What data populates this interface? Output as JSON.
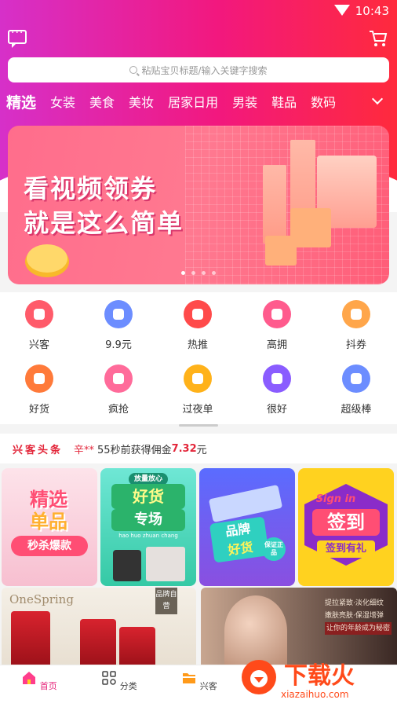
{
  "status_bar": {
    "time": "10:43"
  },
  "search": {
    "placeholder": "粘贴宝贝标题/输入关键字搜索"
  },
  "categories": [
    "精选",
    "女装",
    "美食",
    "美妆",
    "居家日用",
    "男装",
    "鞋品",
    "数码"
  ],
  "banner": {
    "line1": "看视频领券",
    "line2": "就是这么简单",
    "page_count": 4,
    "active_page": 1
  },
  "menu": {
    "row1": [
      {
        "label": "兴客",
        "icon": "clipboard-icon",
        "color": "#ff5b6a"
      },
      {
        "label": "9.9元",
        "icon": "heart-icon",
        "color": "#6c8dff"
      },
      {
        "label": "热推",
        "icon": "flame-icon",
        "color": "#ff4a4a"
      },
      {
        "label": "高拥",
        "icon": "clover-icon",
        "color": "#ff5b8d"
      },
      {
        "label": "抖券",
        "icon": "gift-icon",
        "color": "#ffa64a"
      }
    ],
    "row2": [
      {
        "label": "好货",
        "icon": "burger-icon",
        "color": "#ff7a3a"
      },
      {
        "label": "疯抢",
        "icon": "crown-icon",
        "color": "#ff6b9a"
      },
      {
        "label": "过夜单",
        "icon": "megaphone-icon",
        "color": "#ffb21a"
      },
      {
        "label": "很好",
        "icon": "thumbs-up-icon",
        "color": "#8a5cff"
      },
      {
        "label": "超级棒",
        "icon": "heart-icon",
        "color": "#6c8dff"
      }
    ]
  },
  "news": {
    "label": "兴客头条",
    "user": "辛**",
    "text": "55秒前获得佣金",
    "amount": "7.32",
    "unit": "元"
  },
  "tiles": [
    {
      "line1": "精选",
      "line2": "单品",
      "line3": "秒杀爆款"
    },
    {
      "top": "放量放心",
      "line1": "好货",
      "line2": "专场",
      "sub": "hao huo zhuan chang"
    },
    {
      "line1": "品牌",
      "line2": "好货",
      "badge": "保证正品"
    },
    {
      "en": "Sign in",
      "line1": "签到",
      "line2": "签到有礼"
    }
  ],
  "big_tiles": [
    {
      "brand": "OneSpring",
      "tag": "品牌自营"
    },
    {
      "lines": [
        "提拉紧致·淡化细纹",
        "嫩肤亮肤·保湿增弹",
        "让你的年龄成为秘密"
      ]
    }
  ],
  "tabbar": [
    {
      "label": "首页",
      "icon": "home-icon",
      "active": true
    },
    {
      "label": "分类",
      "icon": "grid-icon",
      "active": false
    },
    {
      "label": "兴客",
      "icon": "folder-icon",
      "active": false
    }
  ],
  "watermark": {
    "text": "下载火",
    "url": "xiazaihuo.com"
  }
}
